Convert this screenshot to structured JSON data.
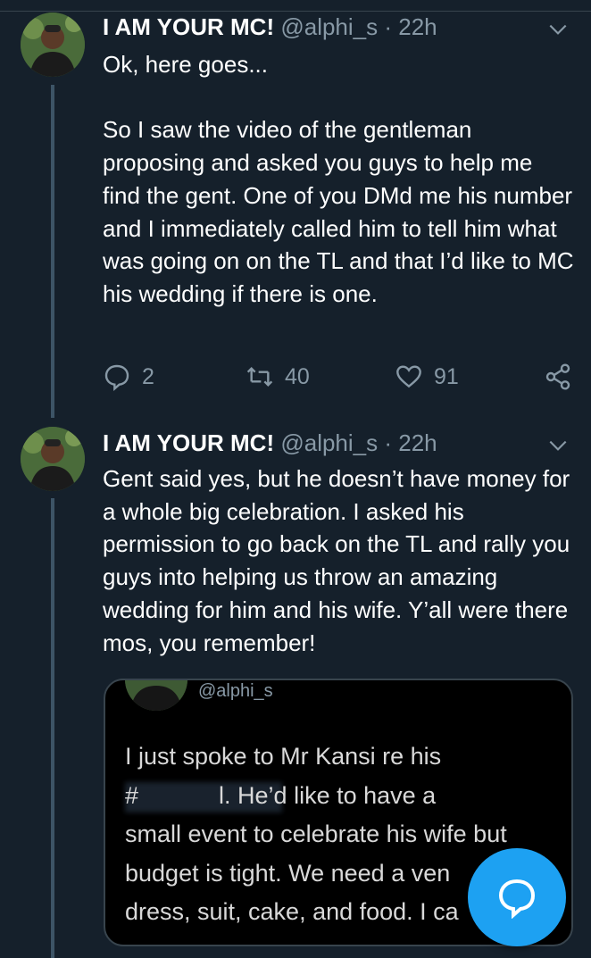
{
  "tweets": [
    {
      "name": "I AM YOUR MC!",
      "handle": "@alphi_s",
      "time": "· 22h",
      "text": "Ok, here goes...\n\nSo I saw the video of the gentleman proposing and asked you guys to help me find the gent. One of you DMd me his number and I immediately called him to tell him what was going on on the TL and that I’d like to MC his wedding if there is one.",
      "replies": "2",
      "retweets": "40",
      "likes": "91"
    },
    {
      "name": "I AM YOUR MC!",
      "handle": "@alphi_s",
      "time": "· 22h",
      "text": "Gent said yes, but he doesn’t have money for a whole big celebration. I asked his permission to go back on the TL and rally you guys into helping us throw an amazing wedding for him and his wife. Y’all were there mos, you remember!"
    }
  ],
  "quoted": {
    "handle": "@alphi_s",
    "text": "I just spoke to Mr Kansi re his\n#            l. He’d like to have a\nsmall event to celebrate his wife but\nbudget is tight. We need a ven\ndress, suit, cake, and food. I ca"
  },
  "icons": {
    "more": "chevron-down-icon",
    "reply": "reply-icon",
    "retweet": "retweet-icon",
    "like": "heart-icon",
    "share": "share-icon",
    "compose": "compose-reply-icon"
  },
  "colors": {
    "background": "#15202b",
    "accent": "#1da1f2",
    "muted": "#8899a6"
  }
}
